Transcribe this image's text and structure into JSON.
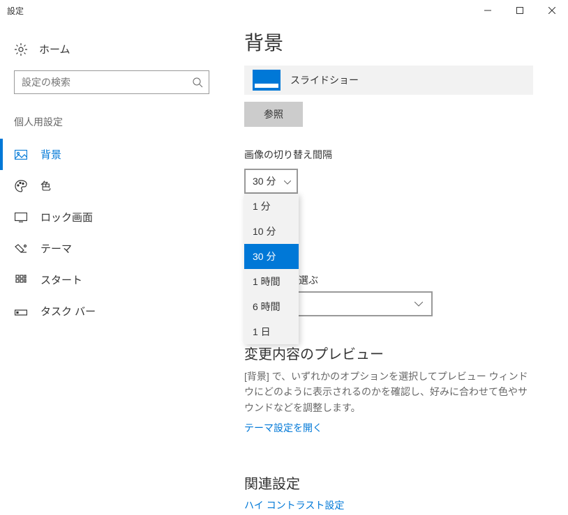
{
  "titlebar": {
    "title": "設定"
  },
  "sidebar": {
    "home_label": "ホーム",
    "search_placeholder": "設定の検索",
    "section_header": "個人用設定",
    "items": [
      {
        "label": "背景",
        "active": true
      },
      {
        "label": "色",
        "active": false
      },
      {
        "label": "ロック画面",
        "active": false
      },
      {
        "label": "テーマ",
        "active": false
      },
      {
        "label": "スタート",
        "active": false
      },
      {
        "label": "タスク バー",
        "active": false
      }
    ]
  },
  "content": {
    "page_title": "背景",
    "slideshow_label": "スライドショー",
    "browse_button": "参照",
    "interval_label": "画像の切り替え間隔",
    "interval_selected": "30 分",
    "interval_options": [
      "1 分",
      "10 分",
      "30 分",
      "1 時間",
      "6 時間",
      "1 日"
    ],
    "partial_text_suffix": "選ぶ",
    "preview_title": "変更内容のプレビュー",
    "preview_desc": "[背景] で、いずれかのオプションを選択してプレビュー ウィンドウにどのように表示されるのかを確認し、好みに合わせて色やサウンドなどを調整します。",
    "theme_link": "テーマ設定を開く",
    "related_title": "関連設定",
    "contrast_link": "ハイ コントラスト設定"
  }
}
